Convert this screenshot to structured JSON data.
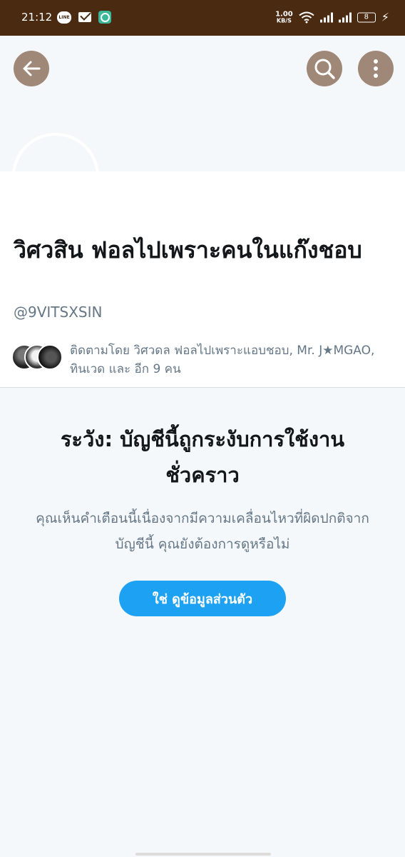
{
  "status_bar": {
    "time": "21:12",
    "line_icon_text": "LINE",
    "speed_value": "1.00",
    "speed_unit": "KB/S",
    "battery": "8"
  },
  "header": {
    "back_icon": "arrow-left-icon",
    "search_icon": "search-icon",
    "more_icon": "more-vertical-icon"
  },
  "profile": {
    "display_name": "วิศวสิน ฟอลไปเพราะคนในแก๊งชอบ",
    "handle": "@9VITSXSIN",
    "followed_by": "ติดตามโดย วิศวดล ฟอลไปเพราะแอบชอบ, Mr. J★MGAO, ทินเวด และ อีก 9 คน"
  },
  "warning": {
    "title": "ระวัง: บัญชีนี้ถูกระงับการใช้งานชั่วคราว",
    "body": "คุณเห็นคำเตือนนี้เนื่องจากมีความเคลื่อนไหวที่ผิดปกติจากบัญชีนี้ คุณยังต้องการดูหรือไม่",
    "confirm_label": "ใช่ ดูข้อมูลส่วนตัว"
  },
  "colors": {
    "status_bar": "#4a2a10",
    "header_button": "#a08878",
    "accent": "#1da1f2",
    "secondary_text": "#657786"
  }
}
